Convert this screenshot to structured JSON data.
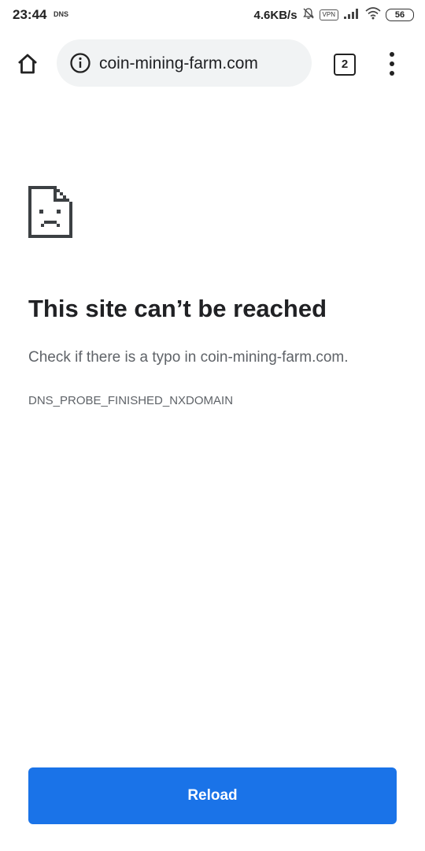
{
  "status_bar": {
    "time": "23:44",
    "dns_label": "DNS",
    "network_speed": "4.6KB/s",
    "vpn_label": "VPN",
    "battery_level": "56",
    "icons": [
      "bell-muted-icon",
      "signal-icon",
      "wifi-icon",
      "battery-icon"
    ]
  },
  "toolbar": {
    "url": "coin-mining-farm.com",
    "tab_count": "2",
    "icons": [
      "home-icon",
      "info-icon",
      "more-vert-icon"
    ]
  },
  "error_page": {
    "icon": "sad-page-icon",
    "title": "This site can’t be reached",
    "description": "Check if there is a typo in coin-mining-farm.com.",
    "error_code": "DNS_PROBE_FINISHED_NXDOMAIN",
    "reload_label": "Reload",
    "accent_color": "#1a73e8"
  }
}
